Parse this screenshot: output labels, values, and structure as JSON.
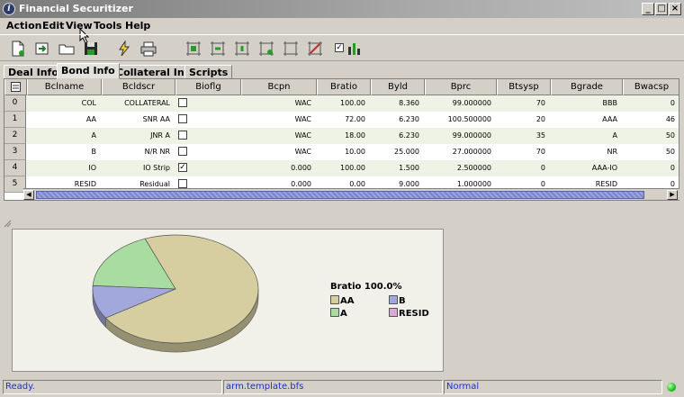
{
  "window": {
    "title": "Financial Securitizer"
  },
  "menu": [
    {
      "label": "Action"
    },
    {
      "label": "Edit"
    },
    {
      "label": "View"
    },
    {
      "label": "Tools"
    },
    {
      "label": "Help"
    }
  ],
  "toolbar": {
    "buttons": [
      "new-file-icon",
      "import-icon",
      "open-folder-icon",
      "save-disk-icon",
      "run-lightning-icon",
      "print-icon",
      "tranche-icon-1",
      "tranche-icon-2",
      "tranche-icon-3",
      "tranche-icon-4",
      "tranche-icon-5",
      "tranche-icon-6",
      "chart-toggle-icon"
    ],
    "chart_checkbox_checked": true
  },
  "tabs": [
    {
      "label": "Deal Info",
      "active": false
    },
    {
      "label": "Bond Info",
      "active": true
    },
    {
      "label": "Collateral Info",
      "active": false
    },
    {
      "label": "Scripts",
      "active": false
    }
  ],
  "table": {
    "columns": [
      "Bclname",
      "Bcldscr",
      "Bioflg",
      "Bcpn",
      "Bratio",
      "Byld",
      "Bprc",
      "Btsysp",
      "Bgrade",
      "Bwacsp"
    ],
    "rows": [
      {
        "num": "0",
        "cells": [
          "COL",
          "COLLATERAL",
          "",
          "WAC",
          "100.00",
          "8.360",
          "99.000000",
          "70",
          "BBB",
          "0"
        ],
        "checked": false
      },
      {
        "num": "1",
        "cells": [
          "AA",
          "SNR AA",
          "",
          "WAC",
          "72.00",
          "6.230",
          "100.500000",
          "20",
          "AAA",
          "46"
        ],
        "checked": false
      },
      {
        "num": "2",
        "cells": [
          "A",
          "JNR A",
          "",
          "WAC",
          "18.00",
          "6.230",
          "99.000000",
          "35",
          "A",
          "50"
        ],
        "checked": false
      },
      {
        "num": "3",
        "cells": [
          "B",
          "N/R NR",
          "",
          "WAC",
          "10.00",
          "25.000",
          "27.000000",
          "70",
          "NR",
          "50"
        ],
        "checked": false
      },
      {
        "num": "4",
        "cells": [
          "IO",
          "IO Strip",
          "",
          "0.000",
          "100.00",
          "1.500",
          "2.500000",
          "0",
          "AAA-IO",
          "0"
        ],
        "checked": true
      },
      {
        "num": "5",
        "cells": [
          "RESID",
          "Residual",
          "",
          "0.000",
          "0.00",
          "9.000",
          "1.000000",
          "0",
          "RESID",
          "0"
        ],
        "checked": false
      }
    ]
  },
  "chart_data": {
    "type": "pie",
    "title": "",
    "legend_title": "Bratio 100.0%",
    "legend_placement": "right",
    "series": [
      {
        "name": "AA",
        "value": 72,
        "color": "#d6ceA0"
      },
      {
        "name": "B",
        "value": 10,
        "color": "#a3a8dc"
      },
      {
        "name": "A",
        "value": 18,
        "color": "#a8dca0"
      },
      {
        "name": "RESID",
        "value": 0,
        "color": "#dca8d8"
      }
    ]
  },
  "status": {
    "message": "Ready.",
    "file": "arm.template.bfs",
    "mode": "Normal"
  }
}
